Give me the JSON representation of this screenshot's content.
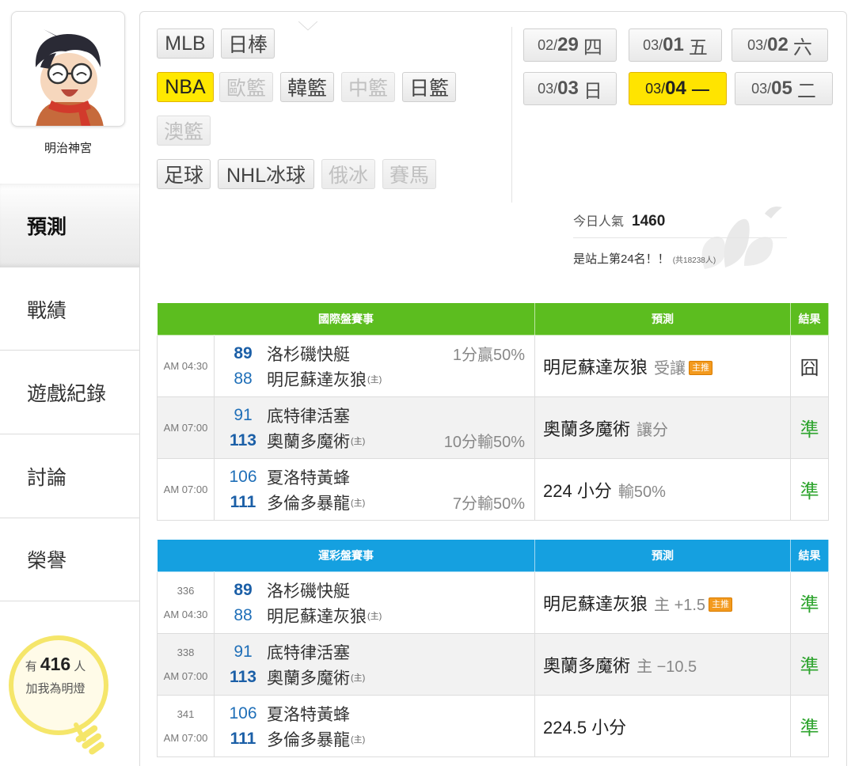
{
  "user": {
    "name": "明治神宮"
  },
  "sidebar": {
    "items": [
      {
        "label": "預測"
      },
      {
        "label": "戰績"
      },
      {
        "label": "遊戲紀錄"
      },
      {
        "label": "討論"
      },
      {
        "label": "榮譽"
      }
    ],
    "fans": {
      "prefix": "有",
      "count": "416",
      "suffix": "人",
      "line2": "加我為明燈"
    }
  },
  "sports": [
    {
      "label": "MLB",
      "state": "normal"
    },
    {
      "label": "日棒",
      "state": "normal"
    },
    {
      "label": "NBA",
      "state": "active"
    },
    {
      "label": "歐籃",
      "state": "disabled"
    },
    {
      "label": "韓籃",
      "state": "normal"
    },
    {
      "label": "中籃",
      "state": "disabled"
    },
    {
      "label": "日籃",
      "state": "normal"
    },
    {
      "label": "澳籃",
      "state": "disabled"
    },
    {
      "label": "足球",
      "state": "normal"
    },
    {
      "label": "NHL冰球",
      "state": "normal"
    },
    {
      "label": "俄冰",
      "state": "disabled"
    },
    {
      "label": "賽馬",
      "state": "disabled"
    }
  ],
  "dates": [
    {
      "month": "02/",
      "day": "29",
      "weekday": "四"
    },
    {
      "month": "03/",
      "day": "01",
      "weekday": "五"
    },
    {
      "month": "03/",
      "day": "02",
      "weekday": "六"
    },
    {
      "month": "03/",
      "day": "03",
      "weekday": "日"
    },
    {
      "month": "03/",
      "day": "04",
      "weekday": "一"
    },
    {
      "month": "03/",
      "day": "05",
      "weekday": "二"
    }
  ],
  "popularity": {
    "label": "今日人氣",
    "value": "1460",
    "rank": "是站上第24名！！",
    "total": "(共18238人)"
  },
  "intl_table": {
    "headers": [
      "國際盤賽事",
      "預測",
      "結果"
    ],
    "rows": [
      {
        "time": "AM 04:30",
        "away": {
          "score": "89",
          "name": "洛杉磯快艇"
        },
        "home": {
          "score": "88",
          "name": "明尼蘇達灰狼",
          "mark": "(主)"
        },
        "spread": "1分贏50%",
        "pick": "明尼蘇達灰狼",
        "pick_sub": "受讓",
        "badge": "主推",
        "result": "囧"
      },
      {
        "time": "AM 07:00",
        "away": {
          "score": "91",
          "name": "底特律活塞"
        },
        "home": {
          "score": "113",
          "name": "奧蘭多魔術",
          "mark": "(主)"
        },
        "spread": "10分輸50%",
        "pick": "奧蘭多魔術",
        "pick_sub": "讓分",
        "result": "準"
      },
      {
        "time": "AM 07:00",
        "away": {
          "score": "106",
          "name": "夏洛特黃蜂"
        },
        "home": {
          "score": "111",
          "name": "多倫多暴龍",
          "mark": "(主)"
        },
        "spread": "7分輸50%",
        "pick": "224 小分",
        "pick_sub": "輸50%",
        "result": "準"
      }
    ]
  },
  "lottery_table": {
    "headers": [
      "運彩盤賽事",
      "預測",
      "結果"
    ],
    "rows": [
      {
        "code": "336",
        "time": "AM 04:30",
        "away": {
          "score": "89",
          "name": "洛杉磯快艇"
        },
        "home": {
          "score": "88",
          "name": "明尼蘇達灰狼",
          "mark": "(主)"
        },
        "pick": "明尼蘇達灰狼",
        "pick_sub": "主 +1.5",
        "badge": "主推",
        "result": "準"
      },
      {
        "code": "338",
        "time": "AM 07:00",
        "away": {
          "score": "91",
          "name": "底特律活塞"
        },
        "home": {
          "score": "113",
          "name": "奧蘭多魔術",
          "mark": "(主)"
        },
        "pick": "奧蘭多魔術",
        "pick_sub": "主 −10.5",
        "result": "準"
      },
      {
        "code": "341",
        "time": "AM 07:00",
        "away": {
          "score": "106",
          "name": "夏洛特黃蜂"
        },
        "home": {
          "score": "111",
          "name": "多倫多暴龍",
          "mark": "(主)"
        },
        "pick": "224.5 小分",
        "result": "準"
      }
    ]
  }
}
